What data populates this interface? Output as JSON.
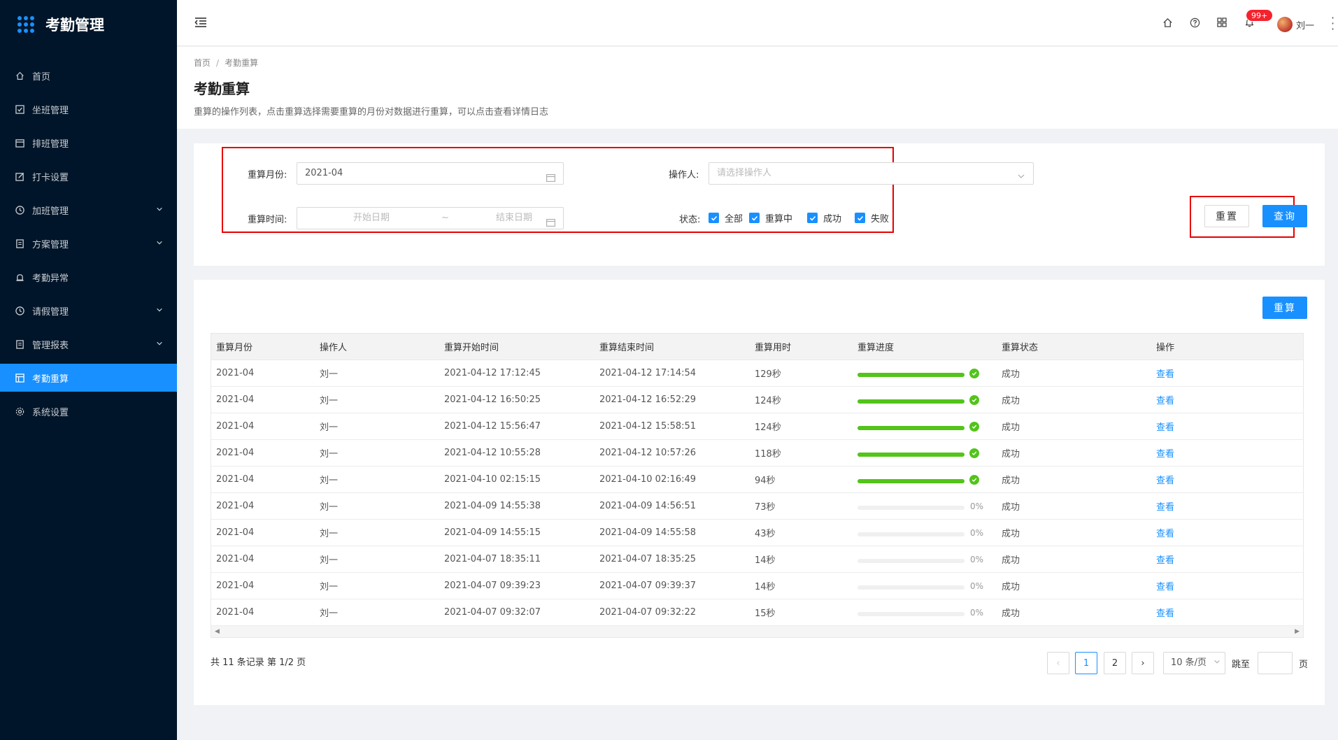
{
  "app": {
    "title": "考勤管理"
  },
  "sidebar": {
    "items": [
      {
        "label": "首页",
        "icon": "home-icon",
        "has_children": false,
        "active": false
      },
      {
        "label": "坐班管理",
        "icon": "checkbox-icon",
        "has_children": false,
        "active": false
      },
      {
        "label": "排班管理",
        "icon": "calendar-icon",
        "has_children": false,
        "active": false
      },
      {
        "label": "打卡设置",
        "icon": "edit-icon",
        "has_children": false,
        "active": false
      },
      {
        "label": "加班管理",
        "icon": "clock-icon",
        "has_children": true,
        "active": false
      },
      {
        "label": "方案管理",
        "icon": "document-icon",
        "has_children": true,
        "active": false
      },
      {
        "label": "考勤异常",
        "icon": "alarm-icon",
        "has_children": false,
        "active": false
      },
      {
        "label": "请假管理",
        "icon": "clock-icon",
        "has_children": true,
        "active": false
      },
      {
        "label": "管理报表",
        "icon": "document-icon",
        "has_children": true,
        "active": false
      },
      {
        "label": "考勤重算",
        "icon": "table-icon",
        "has_children": false,
        "active": true
      },
      {
        "label": "系统设置",
        "icon": "gear-icon",
        "has_children": false,
        "active": false
      }
    ]
  },
  "header": {
    "notification_badge": "99+",
    "username": "刘一"
  },
  "breadcrumb": {
    "home": "首页",
    "current": "考勤重算",
    "separator": "/"
  },
  "page": {
    "title": "考勤重算",
    "description": "重算的操作列表，点击重算选择需要重算的月份对数据进行重算，可以点击查看详情日志"
  },
  "filter": {
    "month_label": "重算月份:",
    "month_value": "2021-04",
    "operator_label": "操作人:",
    "operator_placeholder": "请选择操作人",
    "time_label": "重算时间:",
    "start_placeholder": "开始日期",
    "range_sep": "~",
    "end_placeholder": "结束日期",
    "status_label": "状态:",
    "status_options": [
      {
        "label": "全部",
        "checked": true
      },
      {
        "label": "重算中",
        "checked": true
      },
      {
        "label": "成功",
        "checked": true
      },
      {
        "label": "失败",
        "checked": true
      }
    ],
    "reset_button": "重置",
    "query_button": "查询"
  },
  "table": {
    "recalc_button": "重算",
    "columns": [
      "重算月份",
      "操作人",
      "重算开始时间",
      "重算结束时间",
      "重算用时",
      "重算进度",
      "重算状态",
      "操作"
    ],
    "rows": [
      {
        "month": "2021-04",
        "operator": "刘一",
        "start": "2021-04-12 17:12:45",
        "end": "2021-04-12 17:14:54",
        "duration": "129秒",
        "progress": 100,
        "progress_text": "",
        "status": "成功",
        "action": "查看"
      },
      {
        "month": "2021-04",
        "operator": "刘一",
        "start": "2021-04-12 16:50:25",
        "end": "2021-04-12 16:52:29",
        "duration": "124秒",
        "progress": 100,
        "progress_text": "",
        "status": "成功",
        "action": "查看"
      },
      {
        "month": "2021-04",
        "operator": "刘一",
        "start": "2021-04-12 15:56:47",
        "end": "2021-04-12 15:58:51",
        "duration": "124秒",
        "progress": 100,
        "progress_text": "",
        "status": "成功",
        "action": "查看"
      },
      {
        "month": "2021-04",
        "operator": "刘一",
        "start": "2021-04-12 10:55:28",
        "end": "2021-04-12 10:57:26",
        "duration": "118秒",
        "progress": 100,
        "progress_text": "",
        "status": "成功",
        "action": "查看"
      },
      {
        "month": "2021-04",
        "operator": "刘一",
        "start": "2021-04-10 02:15:15",
        "end": "2021-04-10 02:16:49",
        "duration": "94秒",
        "progress": 100,
        "progress_text": "",
        "status": "成功",
        "action": "查看"
      },
      {
        "month": "2021-04",
        "operator": "刘一",
        "start": "2021-04-09 14:55:38",
        "end": "2021-04-09 14:56:51",
        "duration": "73秒",
        "progress": 0,
        "progress_text": "0%",
        "status": "成功",
        "action": "查看"
      },
      {
        "month": "2021-04",
        "operator": "刘一",
        "start": "2021-04-09 14:55:15",
        "end": "2021-04-09 14:55:58",
        "duration": "43秒",
        "progress": 0,
        "progress_text": "0%",
        "status": "成功",
        "action": "查看"
      },
      {
        "month": "2021-04",
        "operator": "刘一",
        "start": "2021-04-07 18:35:11",
        "end": "2021-04-07 18:35:25",
        "duration": "14秒",
        "progress": 0,
        "progress_text": "0%",
        "status": "成功",
        "action": "查看"
      },
      {
        "month": "2021-04",
        "operator": "刘一",
        "start": "2021-04-07 09:39:23",
        "end": "2021-04-07 09:39:37",
        "duration": "14秒",
        "progress": 0,
        "progress_text": "0%",
        "status": "成功",
        "action": "查看"
      },
      {
        "month": "2021-04",
        "operator": "刘一",
        "start": "2021-04-07 09:32:07",
        "end": "2021-04-07 09:32:22",
        "duration": "15秒",
        "progress": 0,
        "progress_text": "0%",
        "status": "成功",
        "action": "查看"
      }
    ]
  },
  "pagination": {
    "total_text": "共 11 条记录 第 1/2 页",
    "pages": [
      "1",
      "2"
    ],
    "current_page": "1",
    "page_size": "10 条/页",
    "jump_label": "跳至",
    "page_unit": "页"
  },
  "colors": {
    "primary": "#1890ff",
    "sidebar_bg": "#001529",
    "success": "#52c41a",
    "highlight": "#e60000"
  }
}
